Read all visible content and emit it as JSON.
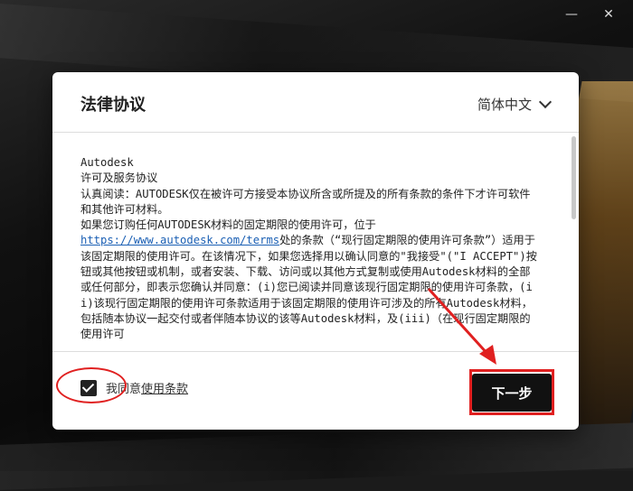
{
  "dialog": {
    "title": "法律协议",
    "language": "简体中文",
    "agreement_lines": [
      "Autodesk",
      "许可及服务协议",
      "认真阅读：AUTODESK仅在被许可方接受本协议所含或所提及的所有条款的条件下才许可软件和其他许可材料。",
      "如果您订购任何AUTODESK材料的固定期限的使用许可，位于"
    ],
    "link_text": "https://www.autodesk.com/terms",
    "after_link": "处的条款（“现行固定期限的使用许可条款”）适用于该固定期限的使用许可。在该情况下，如果您选择用以确认同意的\"我接受\"(\"I ACCEPT\")按钮或其他按钮或机制，或者安装、下载、访问或以其他方式复制或使用Autodesk材料的全部或任何部分，即表示您确认并同意：(i)您已阅读并同意该现行固定期限的使用许可条款，(ii)该现行固定期限的使用许可条款适用于该固定期限的使用许可涉及的所有Autodesk材料，包括随本协议一起交付或者伴随本协议的该等Autodesk材料，及(iii)（在现行固定期限的使用许可",
    "checkbox_label": "我同意",
    "terms_link": "使用条款",
    "next_button": "下一步"
  },
  "window": {
    "minimize": "—",
    "close": "✕"
  },
  "colors": {
    "annotation": "#e02020",
    "button": "#111111",
    "link": "#1a5fb4"
  }
}
